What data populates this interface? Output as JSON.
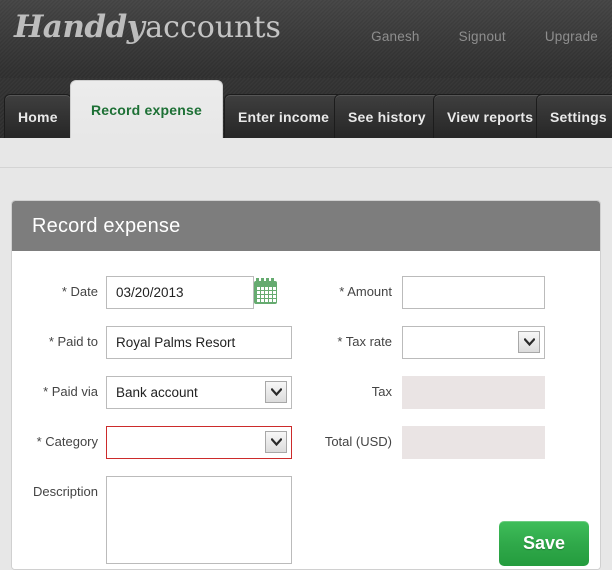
{
  "brand": {
    "name_script": "Handdy",
    "name_plain": "accounts"
  },
  "topnav": {
    "items": [
      {
        "label": "Ganesh",
        "name": "user-menu-link"
      },
      {
        "label": "Signout",
        "name": "signout-link"
      },
      {
        "label": "Upgrade",
        "name": "upgrade-link"
      }
    ]
  },
  "tabs": [
    {
      "label": "Home",
      "active": false
    },
    {
      "label": "Record expense",
      "active": true
    },
    {
      "label": "Enter income",
      "active": false
    },
    {
      "label": "See history",
      "active": false
    },
    {
      "label": "View reports",
      "active": false
    },
    {
      "label": "Settings",
      "active": false
    }
  ],
  "panel": {
    "title": "Record expense"
  },
  "form": {
    "date": {
      "label": "* Date",
      "value": "03/20/2013",
      "placeholder": "",
      "calendar_icon": "calendar-icon"
    },
    "paid_to": {
      "label": "* Paid to",
      "value": "Royal Palms Resort",
      "placeholder": ""
    },
    "paid_via": {
      "label": "* Paid via",
      "value": "Bank account",
      "options": [
        "Bank account"
      ]
    },
    "category": {
      "label": "* Category",
      "value": "",
      "options": [
        ""
      ],
      "invalid": true
    },
    "description": {
      "label": "Description",
      "value": "",
      "placeholder": ""
    },
    "amount": {
      "label": "* Amount",
      "value": "",
      "placeholder": ""
    },
    "tax_rate": {
      "label": "* Tax rate",
      "value": "",
      "options": [
        ""
      ]
    },
    "tax": {
      "label": "Tax",
      "value": "",
      "readonly": true
    },
    "total": {
      "label": "Total (USD)",
      "value": "",
      "readonly": true
    },
    "save": {
      "label": "Save"
    }
  },
  "colors": {
    "header_dark": "#373737",
    "active_tab_text": "#1d7035",
    "panel_header": "#7d7d7d",
    "save_green": "#30a94a",
    "error_red": "#cc2b2b",
    "readonly_bg": "#eae4e4",
    "calendar_green": "#66ab70"
  }
}
